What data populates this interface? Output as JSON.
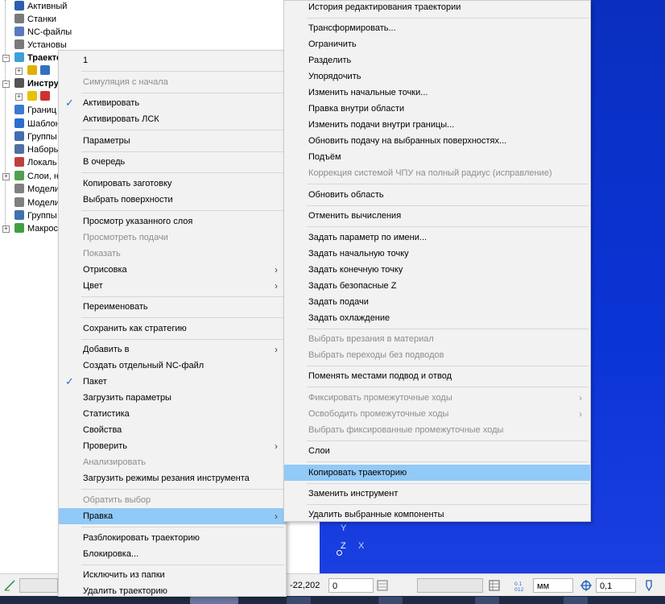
{
  "tree": {
    "items": [
      {
        "label": "Активный",
        "bold": false,
        "color": "#2a5fb0"
      },
      {
        "label": "Станки",
        "bold": false,
        "color": "#7a7a7a"
      },
      {
        "label": "NC-файлы",
        "bold": false,
        "color": "#5a7ac0"
      },
      {
        "label": "Установы",
        "bold": false,
        "color": "#7a7a7a"
      },
      {
        "label": "Траекто",
        "bold": true,
        "color": "#3ea0d8"
      },
      {
        "label": "",
        "bold": false,
        "color": "#e0b000"
      },
      {
        "label": "Инстру",
        "bold": true,
        "color": "#555555"
      },
      {
        "label": "",
        "bold": false,
        "color": "#e8c000"
      },
      {
        "label": "Границ",
        "bold": false,
        "color": "#3a7ad0"
      },
      {
        "label": "Шаблон",
        "bold": false,
        "color": "#2a6fd0"
      },
      {
        "label": "Группы",
        "bold": false,
        "color": "#4070b0"
      },
      {
        "label": "Наборы",
        "bold": false,
        "color": "#5070a0"
      },
      {
        "label": "Локаль",
        "bold": false,
        "color": "#c04040"
      },
      {
        "label": "Слои, н",
        "bold": false,
        "color": "#50a050"
      },
      {
        "label": "Модели",
        "bold": false,
        "color": "#808080"
      },
      {
        "label": "Модели",
        "bold": false,
        "color": "#808080"
      },
      {
        "label": "Группы",
        "bold": false,
        "color": "#4070b0"
      },
      {
        "label": "Макрос",
        "bold": false,
        "color": "#40a040"
      }
    ]
  },
  "menu_left": {
    "items": [
      {
        "label": "1",
        "disabled": false
      },
      {
        "sep": true
      },
      {
        "label": "Симуляция с начала",
        "disabled": true
      },
      {
        "sep": true
      },
      {
        "label": "Активировать",
        "disabled": false,
        "checked": true
      },
      {
        "label": "Активировать ЛСК",
        "disabled": false
      },
      {
        "sep": true
      },
      {
        "label": "Параметры",
        "disabled": false
      },
      {
        "sep": true
      },
      {
        "label": "В очередь",
        "disabled": false
      },
      {
        "sep": true
      },
      {
        "label": "Копировать заготовку",
        "disabled": false
      },
      {
        "label": "Выбрать поверхности",
        "disabled": false
      },
      {
        "sep": true
      },
      {
        "label": "Просмотр указанного слоя",
        "disabled": false
      },
      {
        "label": "Просмотреть подачи",
        "disabled": true
      },
      {
        "label": "Показать",
        "disabled": true
      },
      {
        "label": "Отрисовка",
        "disabled": false,
        "submenu": true
      },
      {
        "label": "Цвет",
        "disabled": false,
        "submenu": true
      },
      {
        "sep": true
      },
      {
        "label": "Переименовать",
        "disabled": false
      },
      {
        "sep": true
      },
      {
        "label": "Сохранить как стратегию",
        "disabled": false
      },
      {
        "sep": true
      },
      {
        "label": "Добавить в",
        "disabled": false,
        "submenu": true
      },
      {
        "label": "Создать отдельный NC-файл",
        "disabled": false
      },
      {
        "label": "Пакет",
        "disabled": false,
        "checked": true
      },
      {
        "label": "Загрузить параметры",
        "disabled": false
      },
      {
        "label": "Статистика",
        "disabled": false
      },
      {
        "label": "Свойства",
        "disabled": false
      },
      {
        "label": "Проверить",
        "disabled": false,
        "submenu": true
      },
      {
        "label": "Анализировать",
        "disabled": true
      },
      {
        "label": "Загрузить режимы резания инструмента",
        "disabled": false
      },
      {
        "sep": true
      },
      {
        "label": "Обратить выбор",
        "disabled": true
      },
      {
        "label": "Правка",
        "disabled": false,
        "submenu": true,
        "highlighted": true
      },
      {
        "sep": true
      },
      {
        "label": "Разблокировать траекторию",
        "disabled": false
      },
      {
        "label": "Блокировка...",
        "disabled": false
      },
      {
        "sep": true
      },
      {
        "label": "Исключить из папки",
        "disabled": false
      },
      {
        "label": "Удалить траекторию",
        "disabled": false
      }
    ]
  },
  "menu_right": {
    "items": [
      {
        "label": "История редактирования траектории",
        "disabled": false
      },
      {
        "sep": true
      },
      {
        "label": "Трансформировать...",
        "disabled": false
      },
      {
        "label": "Ограничить",
        "disabled": false
      },
      {
        "label": "Разделить",
        "disabled": false
      },
      {
        "label": "Упорядочить",
        "disabled": false
      },
      {
        "label": "Изменить начальные точки...",
        "disabled": false
      },
      {
        "label": "Правка внутри области",
        "disabled": false
      },
      {
        "label": "Изменить подачи внутри границы...",
        "disabled": false
      },
      {
        "label": "Обновить подачу на выбранных поверхностях...",
        "disabled": false
      },
      {
        "label": "Подъём",
        "disabled": false
      },
      {
        "label": "Коррекция системой ЧПУ на полный радиус (исправление)",
        "disabled": true
      },
      {
        "sep": true
      },
      {
        "label": "Обновить область",
        "disabled": false
      },
      {
        "sep": true
      },
      {
        "label": "Отменить вычисления",
        "disabled": false
      },
      {
        "sep": true
      },
      {
        "label": "Задать параметр по имени...",
        "disabled": false
      },
      {
        "label": "Задать начальную точку",
        "disabled": false
      },
      {
        "label": "Задать конечную точку",
        "disabled": false
      },
      {
        "label": "Задать безопасные Z",
        "disabled": false
      },
      {
        "label": "Задать подачи",
        "disabled": false
      },
      {
        "label": "Задать охлаждение",
        "disabled": false
      },
      {
        "sep": true
      },
      {
        "label": "Выбрать врезания в материал",
        "disabled": true
      },
      {
        "label": "Выбрать переходы без подводов",
        "disabled": true
      },
      {
        "sep": true
      },
      {
        "label": "Поменять местами подвод и отвод",
        "disabled": false
      },
      {
        "sep": true
      },
      {
        "label": "Фиксировать промежуточные ходы",
        "disabled": true,
        "submenu": true
      },
      {
        "label": "Освободить промежуточные ходы",
        "disabled": true,
        "submenu": true
      },
      {
        "label": "Выбрать фиксированные промежуточные ходы",
        "disabled": true
      },
      {
        "sep": true
      },
      {
        "label": "Слои",
        "disabled": false
      },
      {
        "sep": true
      },
      {
        "label": "Копировать траекторию",
        "disabled": false,
        "highlighted": true
      },
      {
        "sep": true
      },
      {
        "label": "Заменить инструмент",
        "disabled": false
      },
      {
        "sep": true
      },
      {
        "label": "Удалить выбранные компоненты",
        "disabled": false
      }
    ]
  },
  "viewport": {
    "axis_y": "Y",
    "axis_z": "Z",
    "axis_x": "X"
  },
  "statusbar": {
    "coord_value": "-22,202",
    "field2": "0",
    "unit": "мм",
    "tolerance": "0,1"
  },
  "colors": {
    "menu_bg": "#f2f2f2",
    "highlight": "#91c9f7",
    "check": "#2a6ad4",
    "viewport": "#0b34d6"
  }
}
